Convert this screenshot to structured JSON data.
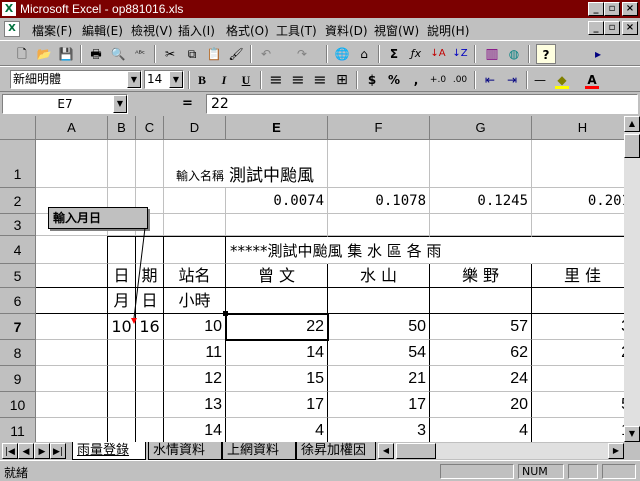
{
  "titlebar": {
    "icon": "X",
    "title": "Microsoft Excel - op881016.xls"
  },
  "window_buttons": {
    "minimize": "_",
    "restore": "▫",
    "close": "×"
  },
  "doc_buttons": {
    "minimize": "_",
    "restore": "▫",
    "close": "×"
  },
  "menu": [
    "檔案(F)",
    "編輯(E)",
    "檢視(V)",
    "插入(I)",
    "格式(O)",
    "工具(T)",
    "資料(D)",
    "視窗(W)",
    "說明(H)"
  ],
  "toolbar_icons": [
    "new-icon",
    "open-icon",
    "save-icon",
    "print-icon",
    "print-preview-icon",
    "spelling-icon",
    "cut-icon",
    "copy-icon",
    "paste-icon",
    "format-painter-icon",
    "undo-icon",
    "redo-icon",
    "hyperlink-icon",
    "web-icon",
    "autosum-icon",
    "function-icon",
    "sort-asc-icon",
    "sort-desc-icon",
    "chart-wizard-icon",
    "map-icon",
    "help-icon"
  ],
  "toolbar_glyphs": {
    "new": "🗋",
    "open": "📂",
    "save": "💾",
    "print": "🖶",
    "preview": "🔍",
    "spell": "ᴬᴮᶜ",
    "cut": "✂",
    "copy": "⧉",
    "paste": "📋",
    "painter": "🖌",
    "undo": "↶",
    "redo": "↷",
    "link": "🌐",
    "web": "⌂",
    "sum": "Σ",
    "fx": "ƒx",
    "sortasc": "↓A",
    "sortdesc": "↓Z",
    "chart": "▥",
    "map": "◍",
    "help": "?",
    "more": "▸"
  },
  "format": {
    "font_name": "新細明體",
    "font_size": "14",
    "bold": "B",
    "italic": "I",
    "underline": "U",
    "currency": "$",
    "percent": "%",
    "comma": ",",
    "align_left": "≡",
    "align_center": "≡",
    "align_right": "≡",
    "merge": "⊞",
    "decimal_inc": "+.0",
    "decimal_dec": ".00",
    "indent_dec": "⇤",
    "indent_inc": "⇥",
    "border": "—",
    "fill_color": "◆",
    "font_color": "A",
    "fill_color_hex": "#ffff00",
    "font_color_hex": "#ff0000"
  },
  "formula_bar": {
    "cell_ref": "E7",
    "equals": "=",
    "value": "22"
  },
  "columns": [
    "A",
    "B",
    "C",
    "D",
    "E",
    "F",
    "G",
    "H"
  ],
  "rows": [
    "1",
    "2",
    "3",
    "4",
    "5",
    "6",
    "7",
    "8",
    "9",
    "10",
    "11"
  ],
  "cells": {
    "D1": "輸入名稱",
    "E1": "測試中颱風",
    "E2": "0.0074",
    "F2": "0.1078",
    "G2": "0.1245",
    "H2": "0.201",
    "E4": "*****測試中颱風 集 水 區 各 雨",
    "B5": "日",
    "C5": "期",
    "D5": "站名",
    "E5": "曾 文",
    "F5": "水 山",
    "G5": "樂 野",
    "H5": "里 佳",
    "B6": "月",
    "C6": "日",
    "D6": "小時",
    "B7": "10",
    "C7": "16",
    "D7": "10",
    "E7": "22",
    "F7": "50",
    "G7": "57",
    "H7": "3",
    "D8": "11",
    "E8": "14",
    "F8": "54",
    "G8": "62",
    "H8": "2",
    "D9": "12",
    "E9": "15",
    "F9": "21",
    "G9": "24",
    "H9": "",
    "D10": "13",
    "E10": "17",
    "F10": "17",
    "G10": "20",
    "H10": "5",
    "D11": "14",
    "E11": "4",
    "F11": "3",
    "G11": "4",
    "H11": "1"
  },
  "comment": "輸入月日",
  "sheet_tabs": [
    "雨量登錄",
    "水情資料",
    "上網資料",
    "徐昇加權因"
  ],
  "tab_nav": [
    "|◀",
    "◀",
    "▶",
    "▶|"
  ],
  "scroll_glyphs": {
    "up": "▲",
    "down": "▼",
    "left": "◀",
    "right": "▶"
  },
  "status": {
    "text": "就緒",
    "num": "NUM"
  }
}
